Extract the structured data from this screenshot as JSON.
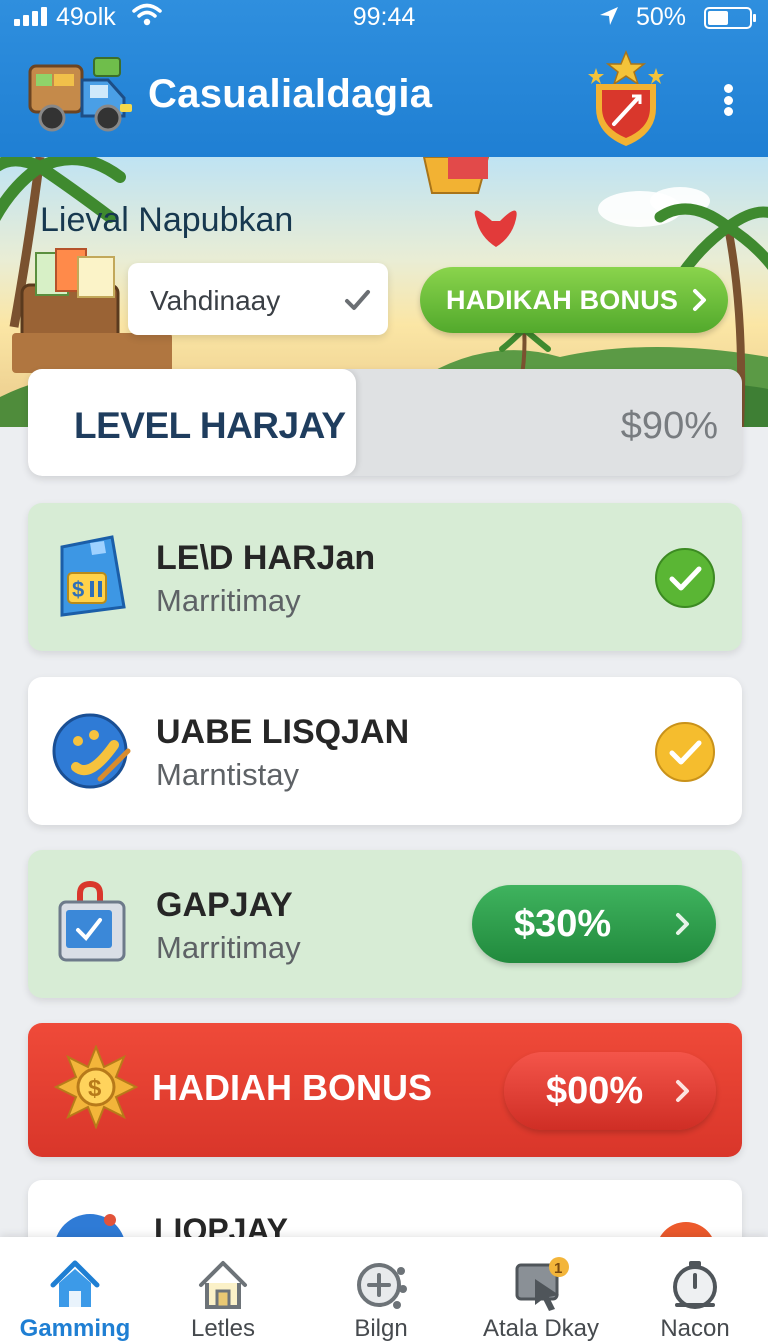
{
  "status_bar": {
    "carrier": "49olk",
    "time": "99:44",
    "battery": "50%"
  },
  "header": {
    "title": "Casualialdagia",
    "truck_icon": "delivery-truck-icon",
    "shield_icon": "shield-badge-icon",
    "menu_icon": "kebab-menu-icon"
  },
  "hero": {
    "title": "Lieval Napubkan",
    "field_value": "Vahdinaay",
    "button_label": "HADIKAH BONUS"
  },
  "level": {
    "title": "LEVEL HARJAY",
    "percent_label": "$90%",
    "progress": 0.46
  },
  "cards": [
    {
      "title": "LE\\D HARJan",
      "subtitle": "Marritimay",
      "icon": "coin-card-icon",
      "status": "green-check-icon"
    },
    {
      "title": "UABE LISQJAN",
      "subtitle": "Marntistay",
      "icon": "globe-icon",
      "status": "yellow-check-icon"
    },
    {
      "title": "GAPJAY",
      "subtitle": "Marritimay",
      "icon": "locked-box-icon",
      "button_label": "$30%"
    }
  ],
  "bonus": {
    "title": "HADIAH BONUS",
    "button_label": "$00%",
    "icon": "gold-sun-coin-icon"
  },
  "partial_card": {
    "title": "LIOPJAY"
  },
  "bottom_nav": [
    {
      "label": "Gamming",
      "icon": "home-icon",
      "active": true
    },
    {
      "label": "Letles",
      "icon": "house-outline-icon",
      "active": false
    },
    {
      "label": "Bilgn",
      "icon": "add-target-icon",
      "active": false
    },
    {
      "label": "Atala Dkay",
      "icon": "cursor-screen-icon",
      "active": false,
      "badge": "1"
    },
    {
      "label": "Nacon",
      "icon": "stopwatch-icon",
      "active": false
    }
  ],
  "colors": {
    "header_blue": "#1f7fd3",
    "green_card": "#d7ecd5",
    "bonus_red": "#e0392c",
    "accent_green": "#52a92c"
  }
}
